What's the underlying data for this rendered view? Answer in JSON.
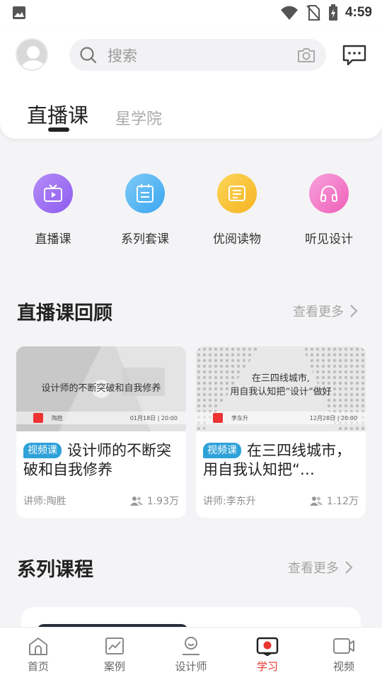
{
  "status_bar": {
    "time": "4:59"
  },
  "header": {
    "search_placeholder": "搜索",
    "tabs": [
      {
        "label": "直播课",
        "active": true
      },
      {
        "label": "星学院",
        "active": false
      }
    ]
  },
  "quick_entries": [
    {
      "label": "直播课",
      "icon": "tv-icon",
      "color": "#9b6cf0"
    },
    {
      "label": "系列套课",
      "icon": "calendar-icon",
      "color": "#4fb3f3"
    },
    {
      "label": "优阅读物",
      "icon": "book-icon",
      "color": "#f9c33a"
    },
    {
      "label": "听见设计",
      "icon": "headphones-icon",
      "color": "#f279c5"
    }
  ],
  "live_review": {
    "title": "直播课回顾",
    "more": "查看更多",
    "cards": [
      {
        "badge": "视频课",
        "title": "设计师的不断突破和自我修养",
        "thumb_title": "设计师的不断突破和自我修养",
        "thumb_speaker": "陶胜",
        "thumb_date": "01月18日 | 20:00",
        "teacher": "讲师:陶胜",
        "views": "1.93万"
      },
      {
        "badge": "视频课",
        "title": "在三四线城市， 用自我认知把“…",
        "thumb_title_line1": "在三四线城市,",
        "thumb_title_line2": "用自我认知把“设计”做好",
        "thumb_speaker": "李东升",
        "thumb_date": "12月28日 | 20:00",
        "teacher": "讲师:李东升",
        "views": "1.12万"
      }
    ]
  },
  "series": {
    "title": "系列课程",
    "more": "查看更多"
  },
  "bottom_nav": [
    {
      "label": "首页",
      "icon": "home-icon",
      "active": false
    },
    {
      "label": "案例",
      "icon": "chart-icon",
      "active": false
    },
    {
      "label": "设计师",
      "icon": "user-icon",
      "active": false
    },
    {
      "label": "学习",
      "icon": "study-icon",
      "active": true
    },
    {
      "label": "视频",
      "icon": "video-icon",
      "active": false
    }
  ],
  "colors": {
    "accent": "#e8362f",
    "badge": "#2ea1d8"
  }
}
